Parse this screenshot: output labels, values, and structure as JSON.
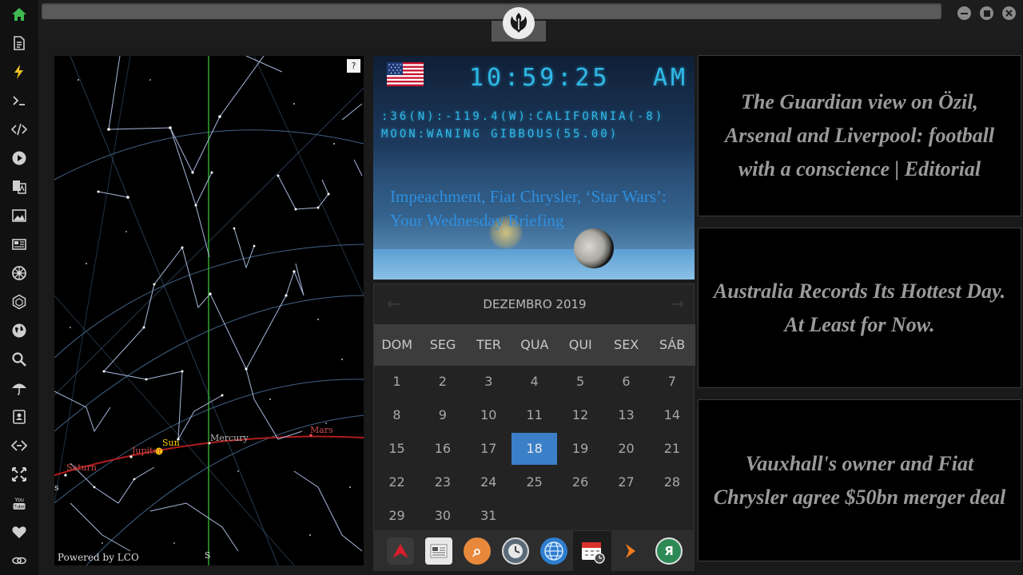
{
  "sky_map": {
    "help_label": "?",
    "credit": "Powered by LCO",
    "south_label": "S",
    "s_label": "s",
    "bodies": [
      "Saturn",
      "Jupiter",
      "Sun",
      "Mercury",
      "Mars"
    ]
  },
  "clock": {
    "time": "10:59:25",
    "ampm": "AM",
    "location": ":36(N):-119.4(W):CALIFORNIA(-8)",
    "moon": "MOON:WANING GIBBOUS(55.00)",
    "briefing": "Impeachment, Fiat Chrysler, ‘Star Wars’: Your Wednesday Briefing"
  },
  "calendar": {
    "month": "DEZEMBRO 2019",
    "weekdays": [
      "DOM",
      "SEG",
      "TER",
      "QUA",
      "QUI",
      "SEX",
      "SÁB"
    ],
    "days": [
      "1",
      "2",
      "3",
      "4",
      "5",
      "6",
      "7",
      "8",
      "9",
      "10",
      "11",
      "12",
      "13",
      "14",
      "15",
      "16",
      "17",
      "18",
      "19",
      "20",
      "21",
      "22",
      "23",
      "24",
      "25",
      "26",
      "27",
      "28",
      "29",
      "30",
      "31"
    ],
    "today": "18",
    "prev_arrow": "←",
    "next_arrow": "→"
  },
  "dock": {
    "search_glyph": "⌕",
    "yandex_glyph": "Я"
  },
  "news": [
    "The Guardian view on Özil, Arsenal and Liverpool: football with a conscience | Editorial",
    "Australia Records Its Hottest Day. At Least for Now.",
    "Vauxhall's owner and Fiat Chrysler agree $50bn merger deal"
  ],
  "colors": {
    "accent_blue": "#3a7fc8",
    "digital_cyan": "#2fb9e8",
    "home_green": "#3fb950",
    "ecliptic_red": "#b01c1c"
  }
}
